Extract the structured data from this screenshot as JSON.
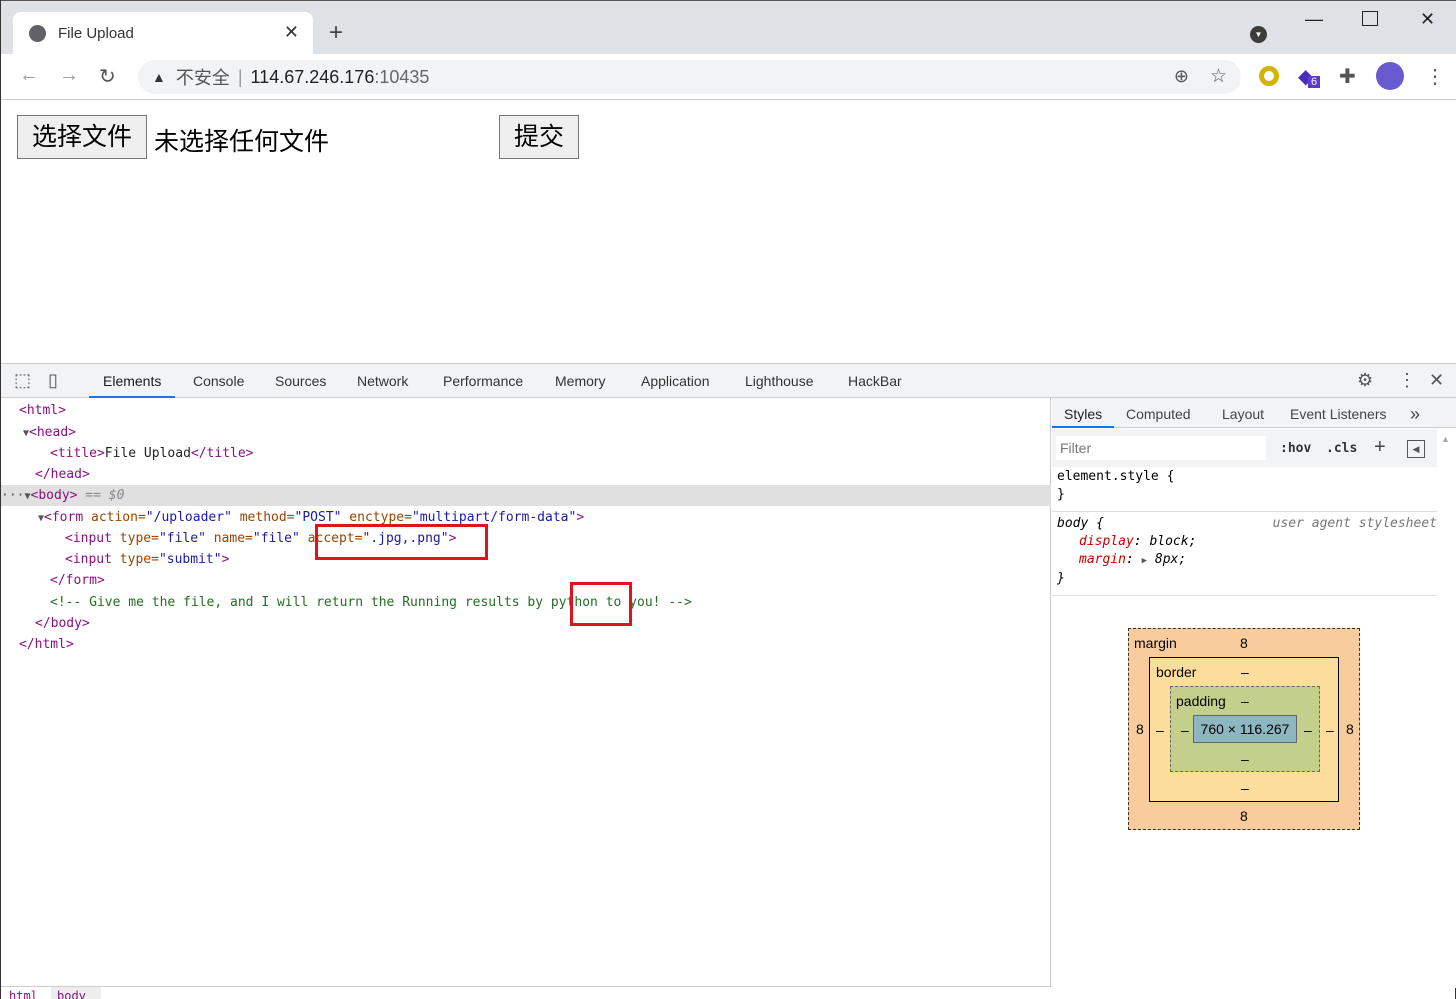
{
  "browser": {
    "tab_title": "File Upload",
    "new_tab": "+",
    "tab_close": "✕",
    "url_warning": "不安全",
    "url_host": "114.67.246.176",
    "url_port": ":10435",
    "extension_badge": "6"
  },
  "page": {
    "choose_file_button": "选择文件",
    "no_file_text": "未选择任何文件",
    "submit_button": "提交"
  },
  "devtools": {
    "tabs": [
      "Elements",
      "Console",
      "Sources",
      "Network",
      "Performance",
      "Memory",
      "Application",
      "Lighthouse",
      "HackBar"
    ],
    "active_tab": "Elements",
    "dom": {
      "l1": "<html>",
      "l2": "<head>",
      "l3a": "<title>",
      "l3b": "File Upload",
      "l3c": "</title>",
      "l4": "</head>",
      "l5": "<body>",
      "l5b": " == $0",
      "form_tag": "<form",
      "form_action_attr": " action=",
      "form_action_val": "\"/uploader\"",
      "form_method_attr": " method=",
      "form_method_val": "\"POST\"",
      "form_enctype_attr": " enctype=",
      "form_enctype_val": "\"multipart/form-data\"",
      "gt": ">",
      "input1_tag": "<input",
      "type_attr": " type=",
      "file_val": "\"file\"",
      "name_attr": " name=",
      "accept_attr": "accept=",
      "accept_val": "\".jpg,.png\"",
      "input2_tag": "<input",
      "submit_val": "\"submit\"",
      "form_close": "</form>",
      "comment_a": "<!-- Give me the file, and I will return the Running results by ",
      "comment_b": "python",
      "comment_c": " to you! -->",
      "body_close": "</body>",
      "html_close": "</html>"
    },
    "styles": {
      "tabs": [
        "Styles",
        "Computed",
        "Layout",
        "Event Listeners"
      ],
      "more": "»",
      "filter_placeholder": "Filter",
      "hov": ":hov",
      "cls": ".cls",
      "r1": "element.style {",
      "r1e": "}",
      "r2": "body {",
      "r2src": "user agent stylesheet",
      "p1n": "display",
      "p1v": "block;",
      "p2n": "margin",
      "p2v": "8px;",
      "r2e": "}"
    },
    "box_model": {
      "margin_label": "margin",
      "margin": "8",
      "border_label": "border",
      "border": "–",
      "padding_label": "padding",
      "padding": "–",
      "content": "760 × 116.267",
      "dash": "–"
    },
    "breadcrumb": [
      "html",
      "body"
    ]
  }
}
